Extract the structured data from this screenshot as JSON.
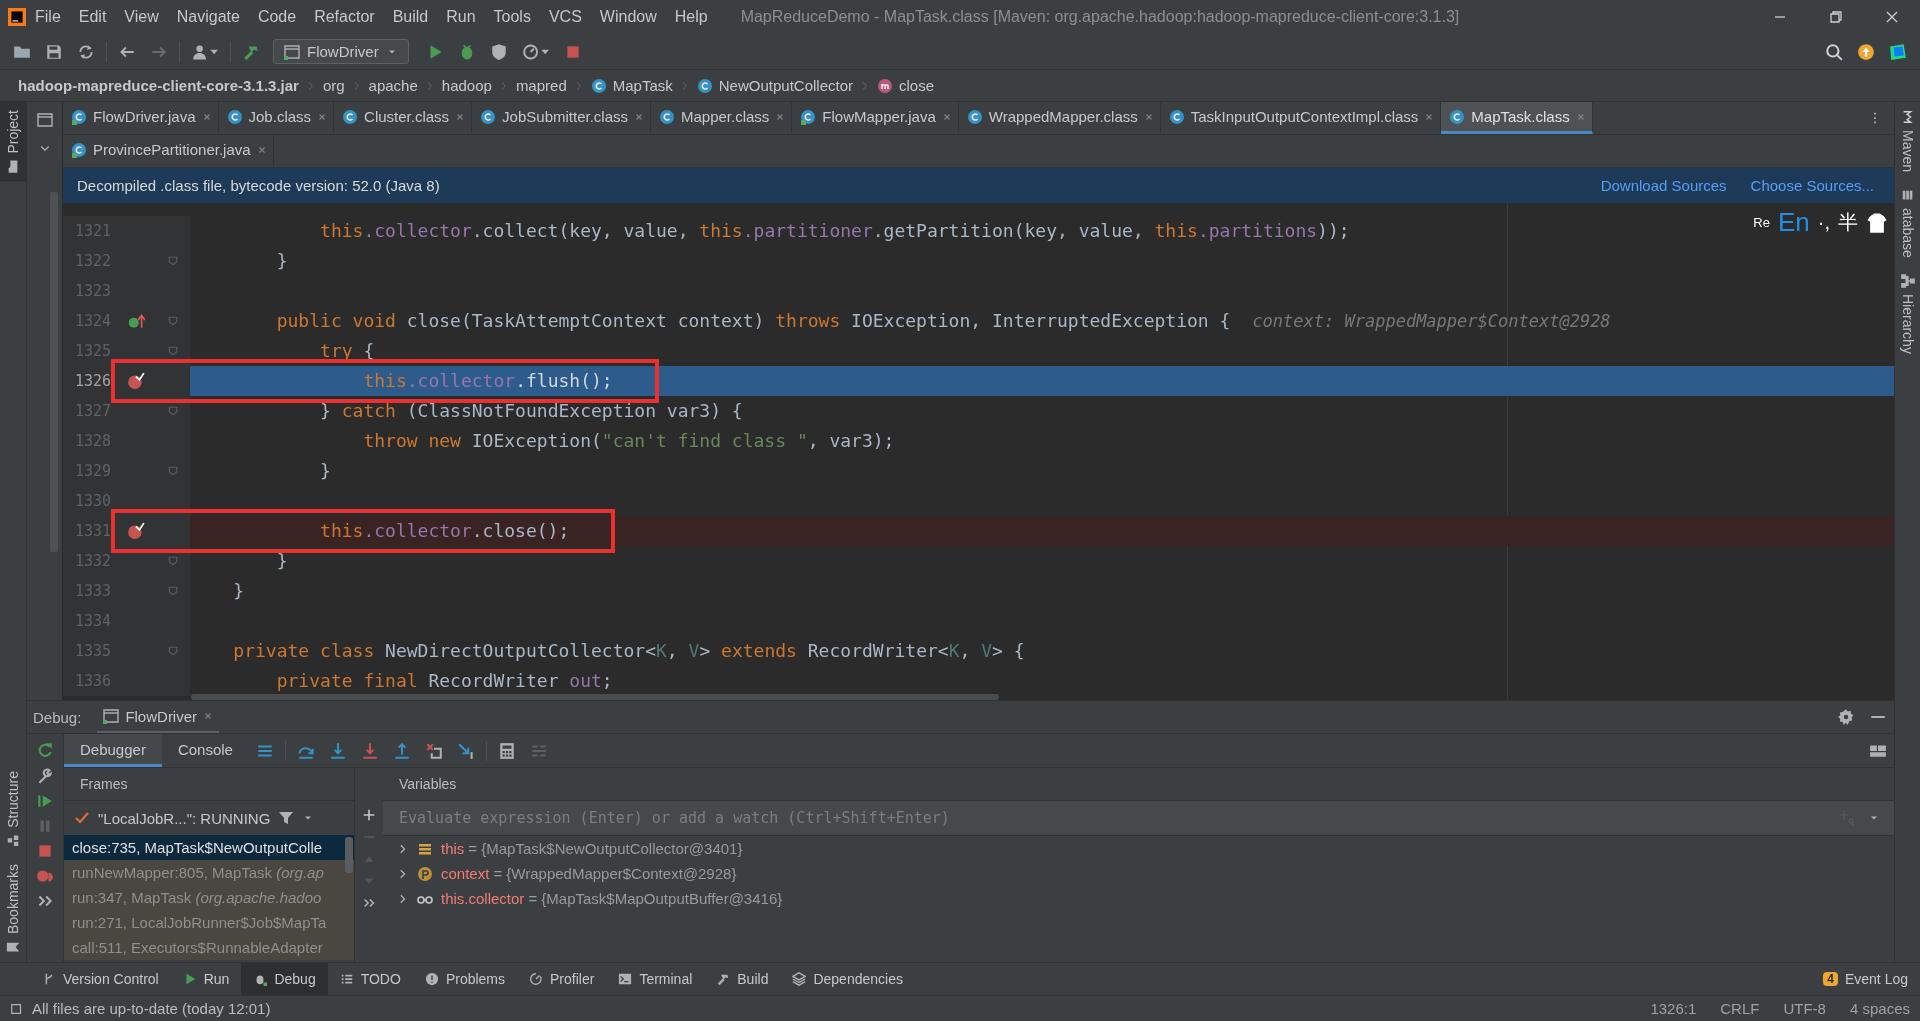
{
  "menu_bar": {
    "items": [
      "File",
      "Edit",
      "View",
      "Navigate",
      "Code",
      "Refactor",
      "Build",
      "Run",
      "Tools",
      "VCS",
      "Window",
      "Help"
    ],
    "title": "MapReduceDemo - MapTask.class [Maven: org.apache.hadoop:hadoop-mapreduce-client-core:3.1.3]"
  },
  "toolbar": {
    "run_configuration": "FlowDriver"
  },
  "breadcrumbs": [
    {
      "label": "hadoop-mapreduce-client-core-3.1.3.jar",
      "kind": "jar"
    },
    {
      "label": "org",
      "kind": "package"
    },
    {
      "label": "apache",
      "kind": "package"
    },
    {
      "label": "hadoop",
      "kind": "package"
    },
    {
      "label": "mapred",
      "kind": "package"
    },
    {
      "label": "MapTask",
      "kind": "class"
    },
    {
      "label": "NewOutputCollector",
      "kind": "class"
    },
    {
      "label": "close",
      "kind": "method"
    }
  ],
  "left_tool_windows": {
    "top": [
      "Project"
    ],
    "bottom": [
      "Structure",
      "Bookmarks"
    ]
  },
  "right_tool_windows": [
    "Maven",
    "atabase",
    "Hierarchy"
  ],
  "tab_rows": [
    {
      "tabs": [
        {
          "label": "FlowDriver.java",
          "kind": "java",
          "selected": false
        },
        {
          "label": "Job.class",
          "kind": "class",
          "selected": false
        },
        {
          "label": "Cluster.class",
          "kind": "class",
          "selected": false
        },
        {
          "label": "JobSubmitter.class",
          "kind": "class",
          "selected": false
        },
        {
          "label": "Mapper.class",
          "kind": "class",
          "selected": false
        },
        {
          "label": "FlowMapper.java",
          "kind": "java",
          "selected": false
        },
        {
          "label": "WrappedMapper.class",
          "kind": "class",
          "selected": false
        },
        {
          "label": "TaskInputOutputContextImpl.class",
          "kind": "class",
          "selected": false
        },
        {
          "label": "MapTask.class",
          "kind": "class",
          "selected": true
        }
      ]
    },
    {
      "tabs": [
        {
          "label": "ProvincePartitioner.java",
          "kind": "java",
          "selected": false
        }
      ]
    }
  ],
  "banner": {
    "message": "Decompiled .class file, bytecode version: 52.0 (Java 8)",
    "links": [
      "Download Sources",
      "Choose Sources..."
    ]
  },
  "ime_bar": {
    "items": [
      "Re",
      "En",
      "·,",
      "半"
    ]
  },
  "code": {
    "lines": [
      {
        "number": "1321",
        "implemented": false,
        "breakpoint": false,
        "current": false,
        "fold": false,
        "boxed": false,
        "tokens": [
          {
            "text": "            this",
            "kind": "kw"
          },
          {
            "text": ".collector",
            "kind": "field"
          },
          {
            "text": ".collect(key, value, ",
            "kind": "plain"
          },
          {
            "text": "this",
            "kind": "kw"
          },
          {
            "text": ".partitioner",
            "kind": "field"
          },
          {
            "text": ".getPartition(key, value, ",
            "kind": "plain"
          },
          {
            "text": "this",
            "kind": "kw"
          },
          {
            "text": ".partitions",
            "kind": "field"
          },
          {
            "text": "));",
            "kind": "plain"
          }
        ]
      },
      {
        "number": "1322",
        "implemented": false,
        "breakpoint": false,
        "current": false,
        "fold": true,
        "boxed": false,
        "tokens": [
          {
            "text": "        }",
            "kind": "plain"
          }
        ]
      },
      {
        "number": "1323",
        "implemented": false,
        "breakpoint": false,
        "current": false,
        "fold": false
      },
      {
        "number": "1324",
        "implemented": true,
        "breakpoint": false,
        "current": false,
        "fold": true,
        "boxed": false,
        "hint": "context: WrappedMapper$Context@2928",
        "tokens": [
          {
            "text": "        public void ",
            "kind": "kw"
          },
          {
            "text": "close(TaskAttemptContext context) ",
            "kind": "plain"
          },
          {
            "text": "throws ",
            "kind": "kw"
          },
          {
            "text": "IOException, InterruptedException {",
            "kind": "plain"
          }
        ]
      },
      {
        "number": "1325",
        "implemented": false,
        "breakpoint": false,
        "current": false,
        "fold": true,
        "boxed": false,
        "tokens": [
          {
            "text": "            try ",
            "kind": "kw"
          },
          {
            "text": "{",
            "kind": "plain"
          }
        ]
      },
      {
        "number": "1326",
        "implemented": false,
        "breakpoint": true,
        "current": true,
        "fold": false,
        "boxed": true,
        "tokens": [
          {
            "text": "                this",
            "kind": "kw"
          },
          {
            "text": ".collector",
            "kind": "field"
          },
          {
            "text": ".flush();",
            "kind": "plain"
          }
        ]
      },
      {
        "number": "1327",
        "implemented": false,
        "breakpoint": false,
        "current": false,
        "fold": true,
        "boxed": false,
        "tokens": [
          {
            "text": "            } ",
            "kind": "plain"
          },
          {
            "text": "catch ",
            "kind": "kw"
          },
          {
            "text": "(ClassNotFoundException var3) {",
            "kind": "plain"
          }
        ]
      },
      {
        "number": "1328",
        "implemented": false,
        "breakpoint": false,
        "current": false,
        "fold": false,
        "boxed": false,
        "tokens": [
          {
            "text": "                throw new ",
            "kind": "kw"
          },
          {
            "text": "IOException(",
            "kind": "plain"
          },
          {
            "text": "\"can't find class \"",
            "kind": "str"
          },
          {
            "text": ", var3);",
            "kind": "plain"
          }
        ]
      },
      {
        "number": "1329",
        "implemented": false,
        "breakpoint": false,
        "current": false,
        "fold": true,
        "boxed": false,
        "tokens": [
          {
            "text": "            }",
            "kind": "plain"
          }
        ]
      },
      {
        "number": "1330",
        "implemented": false,
        "breakpoint": false,
        "current": false,
        "fold": false
      },
      {
        "number": "1331",
        "implemented": false,
        "breakpoint": true,
        "current": false,
        "fold": false,
        "boxed": true,
        "tokens": [
          {
            "text": "            this",
            "kind": "kw"
          },
          {
            "text": ".collector",
            "kind": "field"
          },
          {
            "text": ".close();",
            "kind": "plain"
          }
        ]
      },
      {
        "number": "1332",
        "implemented": false,
        "breakpoint": false,
        "current": false,
        "fold": true,
        "boxed": false,
        "tokens": [
          {
            "text": "        }",
            "kind": "plain"
          }
        ]
      },
      {
        "number": "1333",
        "implemented": false,
        "breakpoint": false,
        "current": false,
        "fold": true,
        "boxed": false,
        "tokens": [
          {
            "text": "    }",
            "kind": "plain"
          }
        ]
      },
      {
        "number": "1334",
        "implemented": false,
        "breakpoint": false,
        "current": false,
        "fold": false
      },
      {
        "number": "1335",
        "implemented": false,
        "breakpoint": false,
        "current": false,
        "fold": true,
        "boxed": false,
        "tokens": [
          {
            "text": "    private class ",
            "kind": "kw"
          },
          {
            "text": "NewDirectOutputCollector<",
            "kind": "plain"
          },
          {
            "text": "K",
            "kind": "tparam"
          },
          {
            "text": ", ",
            "kind": "plain"
          },
          {
            "text": "V",
            "kind": "tparam"
          },
          {
            "text": "> ",
            "kind": "plain"
          },
          {
            "text": "extends ",
            "kind": "kw"
          },
          {
            "text": "RecordWriter<",
            "kind": "plain"
          },
          {
            "text": "K",
            "kind": "tparam"
          },
          {
            "text": ", ",
            "kind": "plain"
          },
          {
            "text": "V",
            "kind": "tparam"
          },
          {
            "text": "> {",
            "kind": "plain"
          }
        ]
      },
      {
        "number": "1336",
        "implemented": false,
        "breakpoint": false,
        "current": false,
        "fold": false,
        "boxed": false,
        "tokens": [
          {
            "text": "        private final ",
            "kind": "kw"
          },
          {
            "text": "RecordWriter ",
            "kind": "plain"
          },
          {
            "text": "out",
            "kind": "field"
          },
          {
            "text": ";",
            "kind": "plain"
          }
        ]
      }
    ]
  },
  "debug": {
    "label": "Debug:",
    "session_tab": "FlowDriver",
    "tabs": [
      {
        "label": "Debugger",
        "selected": true
      },
      {
        "label": "Console",
        "selected": false
      }
    ],
    "frames_title": "Frames",
    "variables_title": "Variables",
    "thread": "\"LocalJobR...\": RUNNING",
    "frames": [
      {
        "text": "close:735, MapTask$NewOutputColle",
        "selected": true,
        "library": false
      },
      {
        "text": "runNewMapper:805, MapTask *(org.ap*",
        "selected": false,
        "library": true
      },
      {
        "text": "run:347, MapTask *(org.apache.hadoo*",
        "selected": false,
        "library": true
      },
      {
        "text": "run:271, LocalJobRunner$Job$MapTa",
        "selected": false,
        "library": true
      },
      {
        "text": "call:511, Executors$RunnableAdapter",
        "selected": false,
        "library": true
      }
    ],
    "evaluate_placeholder": "Evaluate expression (Enter) or add a watch (Ctrl+Shift+Enter)",
    "variables": [
      {
        "kind": "fields",
        "name": "this",
        "value": "= {MapTask$NewOutputCollector@3401}"
      },
      {
        "kind": "parameter",
        "name": "context",
        "value": "= {WrappedMapper$Context@2928}"
      },
      {
        "kind": "watch",
        "name": "this.collector",
        "value": "= {MapTask$MapOutputBuffer@3416}"
      }
    ]
  },
  "tool_tabs": [
    {
      "label": "Version Control",
      "kind": "vcs",
      "selected": false
    },
    {
      "label": "Run",
      "kind": "run",
      "selected": false
    },
    {
      "label": "Debug",
      "kind": "debug",
      "selected": true
    },
    {
      "label": "TODO",
      "kind": "todo",
      "selected": false
    },
    {
      "label": "Problems",
      "kind": "problems",
      "selected": false
    },
    {
      "label": "Profiler",
      "kind": "profiler",
      "selected": false
    },
    {
      "label": "Terminal",
      "kind": "terminal",
      "selected": false
    },
    {
      "label": "Build",
      "kind": "build",
      "selected": false
    },
    {
      "label": "Dependencies",
      "kind": "dependencies",
      "selected": false
    }
  ],
  "event_log": {
    "badge": "4",
    "label": "Event Log"
  },
  "status_bar": {
    "message": "All files are up-to-date (today 12:01)",
    "position": "1326:1",
    "line_separator": "CRLF",
    "encoding": "UTF-8",
    "indent": "4 spaces"
  }
}
